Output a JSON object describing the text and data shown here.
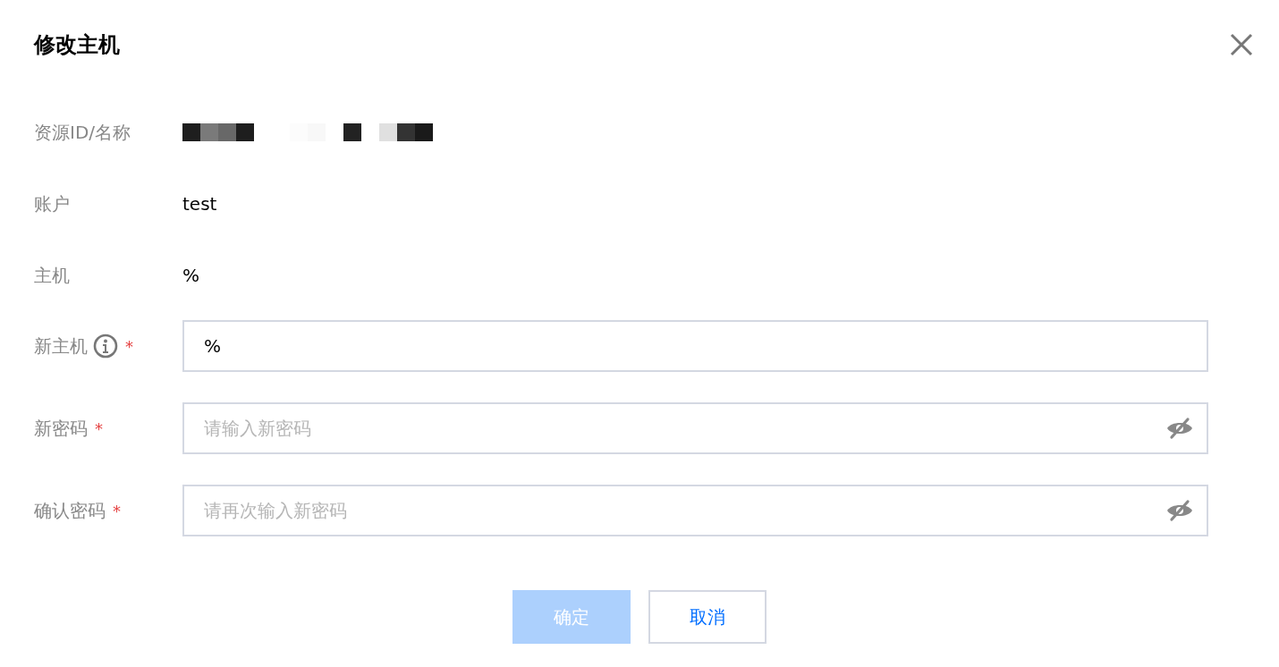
{
  "dialog": {
    "title": "修改主机"
  },
  "rows": [
    {
      "kind": "redacted",
      "label": "资源ID/名称"
    },
    {
      "kind": "text",
      "label": "账户",
      "value": "test"
    },
    {
      "kind": "text",
      "label": "主机",
      "value": "%"
    },
    {
      "kind": "input",
      "label": "新主机",
      "info": true,
      "required_mark": "*",
      "value": "%"
    },
    {
      "kind": "password",
      "label": "新密码",
      "required_mark": "*",
      "placeholder": "请输入新密码",
      "hidden": true
    },
    {
      "kind": "password",
      "label": "确认密码",
      "required_mark": "*",
      "placeholder": "请再次输入新密码",
      "hidden": true
    }
  ],
  "buttons": [
    {
      "label": "确定",
      "kind": "primary",
      "disabled": true
    },
    {
      "label": "取消",
      "kind": "secondary",
      "disabled": false
    }
  ]
}
